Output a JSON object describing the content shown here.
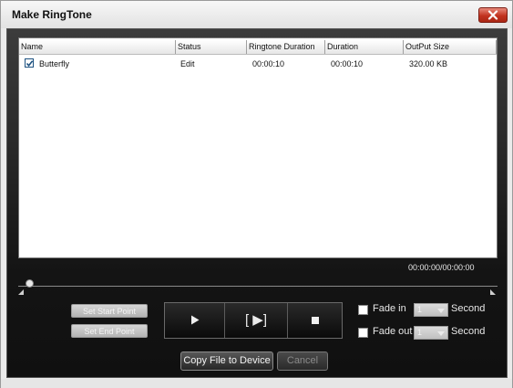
{
  "window": {
    "title": "Make RingTone"
  },
  "table": {
    "columns": [
      "Name",
      "Status",
      "Ringtone Duration",
      "Duration",
      "OutPut Size"
    ],
    "rows": [
      {
        "checked": true,
        "name": "Butterfly",
        "status": "Edit",
        "ringtone_duration": "00:00:10",
        "duration": "00:00:10",
        "output_size": "320.00 KB"
      }
    ]
  },
  "time_display": "00:00:00/00:00:00",
  "controls": {
    "set_start": "Set Start Point",
    "set_end": "Set End Point",
    "play_icon": "play-icon",
    "play_segment_label": "[ ▶]",
    "stop_icon": "stop-icon",
    "fade_in_label": "Fade in",
    "fade_out_label": "Fade out",
    "fade_in_value": "1",
    "fade_out_value": "1",
    "second_label": "Second",
    "copy_to_device": "Copy File to Device",
    "cancel": "Cancel"
  },
  "colors": {
    "close_button": "#c2331f",
    "panel_bg": "#141414",
    "checkbox_check": "#1c5180"
  }
}
